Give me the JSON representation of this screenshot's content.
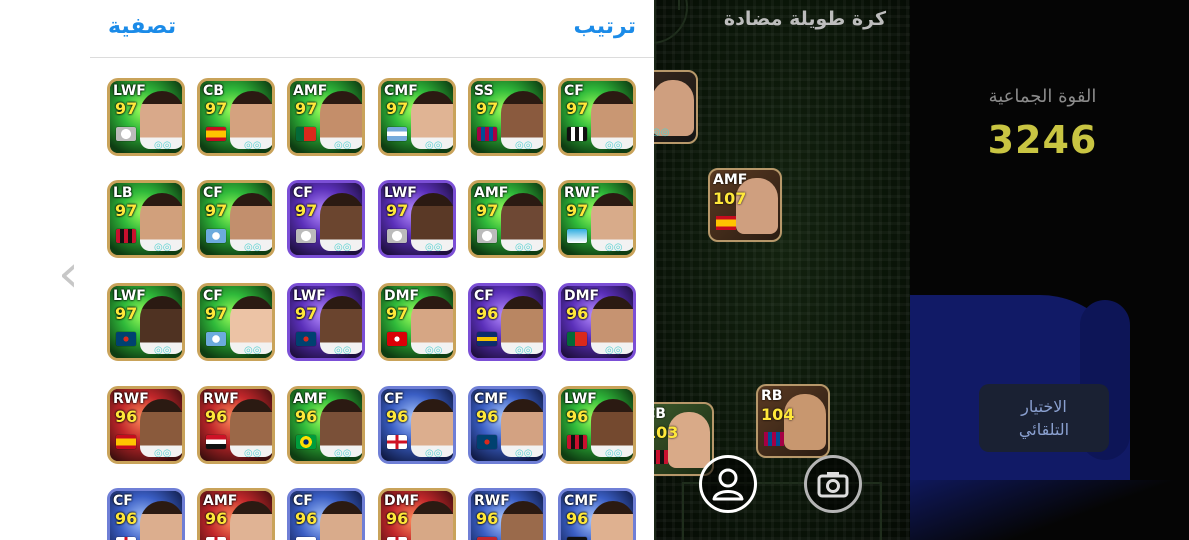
{
  "panel": {
    "filter_label": "تصفية",
    "sort_label": "ترتيب"
  },
  "formation_title": "كرة طويلة مضادة",
  "team_strength": {
    "label": "القوة الجماعية",
    "value": "3246"
  },
  "auto_select_label": "الاختيار\nالتلقائي",
  "cards": [
    {
      "pos": "LWF",
      "rating": "97",
      "theme": "green",
      "flag": "club-white",
      "skin": "#d9a98a"
    },
    {
      "pos": "CB",
      "rating": "97",
      "theme": "green",
      "flag": "spain",
      "skin": "#d4a27f"
    },
    {
      "pos": "AMF",
      "rating": "97",
      "theme": "green",
      "flag": "portugal",
      "skin": "#c48e6a"
    },
    {
      "pos": "CMF",
      "rating": "97",
      "theme": "green",
      "flag": "club-argentina",
      "skin": "#e0b494"
    },
    {
      "pos": "SS",
      "rating": "97",
      "theme": "green",
      "flag": "barcelona",
      "skin": "#8a5a3e"
    },
    {
      "pos": "CF",
      "rating": "97",
      "theme": "green",
      "flag": "club-santos",
      "skin": "#c99773"
    },
    {
      "pos": "LB",
      "rating": "97",
      "theme": "green",
      "flag": "milan",
      "skin": "#d1a07c"
    },
    {
      "pos": "CF",
      "rating": "97",
      "theme": "green",
      "flag": "club-sky",
      "skin": "#c28f6d"
    },
    {
      "pos": "CF",
      "rating": "97",
      "theme": "purple",
      "flag": "club-white",
      "skin": "#6b452f"
    },
    {
      "pos": "LWF",
      "rating": "97",
      "theme": "purple",
      "flag": "club-white",
      "skin": "#5a3926"
    },
    {
      "pos": "AMF",
      "rating": "97",
      "theme": "green",
      "flag": "club-white",
      "skin": "#6e4834"
    },
    {
      "pos": "RWF",
      "rating": "97",
      "theme": "green",
      "flag": "marseille",
      "skin": "#d8ab8a"
    },
    {
      "pos": "LWF",
      "rating": "97",
      "theme": "green",
      "flag": "psg",
      "skin": "#4f3222"
    },
    {
      "pos": "CF",
      "rating": "97",
      "theme": "green",
      "flag": "club-sky",
      "skin": "#ecc3a5"
    },
    {
      "pos": "LWF",
      "rating": "97",
      "theme": "purple",
      "flag": "psg",
      "skin": "#6a442e"
    },
    {
      "pos": "DMF",
      "rating": "97",
      "theme": "green",
      "flag": "arsenal",
      "skin": "#d6a684"
    },
    {
      "pos": "CF",
      "rating": "96",
      "theme": "purple",
      "flag": "boca",
      "skin": "#b98662"
    },
    {
      "pos": "DMF",
      "rating": "96",
      "theme": "purple",
      "flag": "portugal",
      "skin": "#c69371"
    },
    {
      "pos": "RWF",
      "rating": "96",
      "theme": "red",
      "flag": "spain",
      "skin": "#8a5a3c"
    },
    {
      "pos": "RWF",
      "rating": "96",
      "theme": "red",
      "flag": "egypt",
      "skin": "#9b6848"
    },
    {
      "pos": "AMF",
      "rating": "96",
      "theme": "green",
      "flag": "brazil",
      "skin": "#7a5038"
    },
    {
      "pos": "CF",
      "rating": "96",
      "theme": "blue",
      "flag": "england",
      "skin": "#dcae8e"
    },
    {
      "pos": "CMF",
      "rating": "96",
      "theme": "blue",
      "flag": "psg",
      "skin": "#d3a282"
    },
    {
      "pos": "LWF",
      "rating": "96",
      "theme": "green",
      "flag": "milan",
      "skin": "#74492f"
    },
    {
      "pos": "CF",
      "rating": "96",
      "theme": "blue",
      "flag": "england",
      "skin": "#dcae8e"
    },
    {
      "pos": "AMF",
      "rating": "96",
      "theme": "red",
      "flag": "england",
      "skin": "#e0b394"
    },
    {
      "pos": "CF",
      "rating": "96",
      "theme": "blue",
      "flag": "tottenham",
      "skin": "#d9ab8b"
    },
    {
      "pos": "DMF",
      "rating": "96",
      "theme": "red",
      "flag": "england",
      "skin": "#d7a886"
    },
    {
      "pos": "RWF",
      "rating": "96",
      "theme": "blue",
      "flag": "morocco",
      "skin": "#9a6a4b"
    },
    {
      "pos": "CMF",
      "rating": "96",
      "theme": "blue",
      "flag": "germany",
      "skin": "#dfb190"
    }
  ],
  "pitch_players": [
    {
      "pos": "",
      "rating": "",
      "flag": "",
      "skin": "#cf9f7f"
    },
    {
      "pos": "AMF",
      "rating": "107",
      "flag": "spain",
      "skin": "#cf9f7f"
    },
    {
      "pos": "CB",
      "rating": "103",
      "flag": "milan",
      "skin": "#d9aa88"
    },
    {
      "pos": "RB",
      "rating": "104",
      "flag": "barcelona",
      "skin": "#c8976f"
    }
  ],
  "icons": {
    "profile": "person-icon",
    "camera": "camera-icon",
    "back": "chevron-left-icon"
  },
  "colors": {
    "accent_blue": "#1b8be8",
    "team_strength": "#c9c542",
    "rating_yellow": "#ffe83a"
  }
}
